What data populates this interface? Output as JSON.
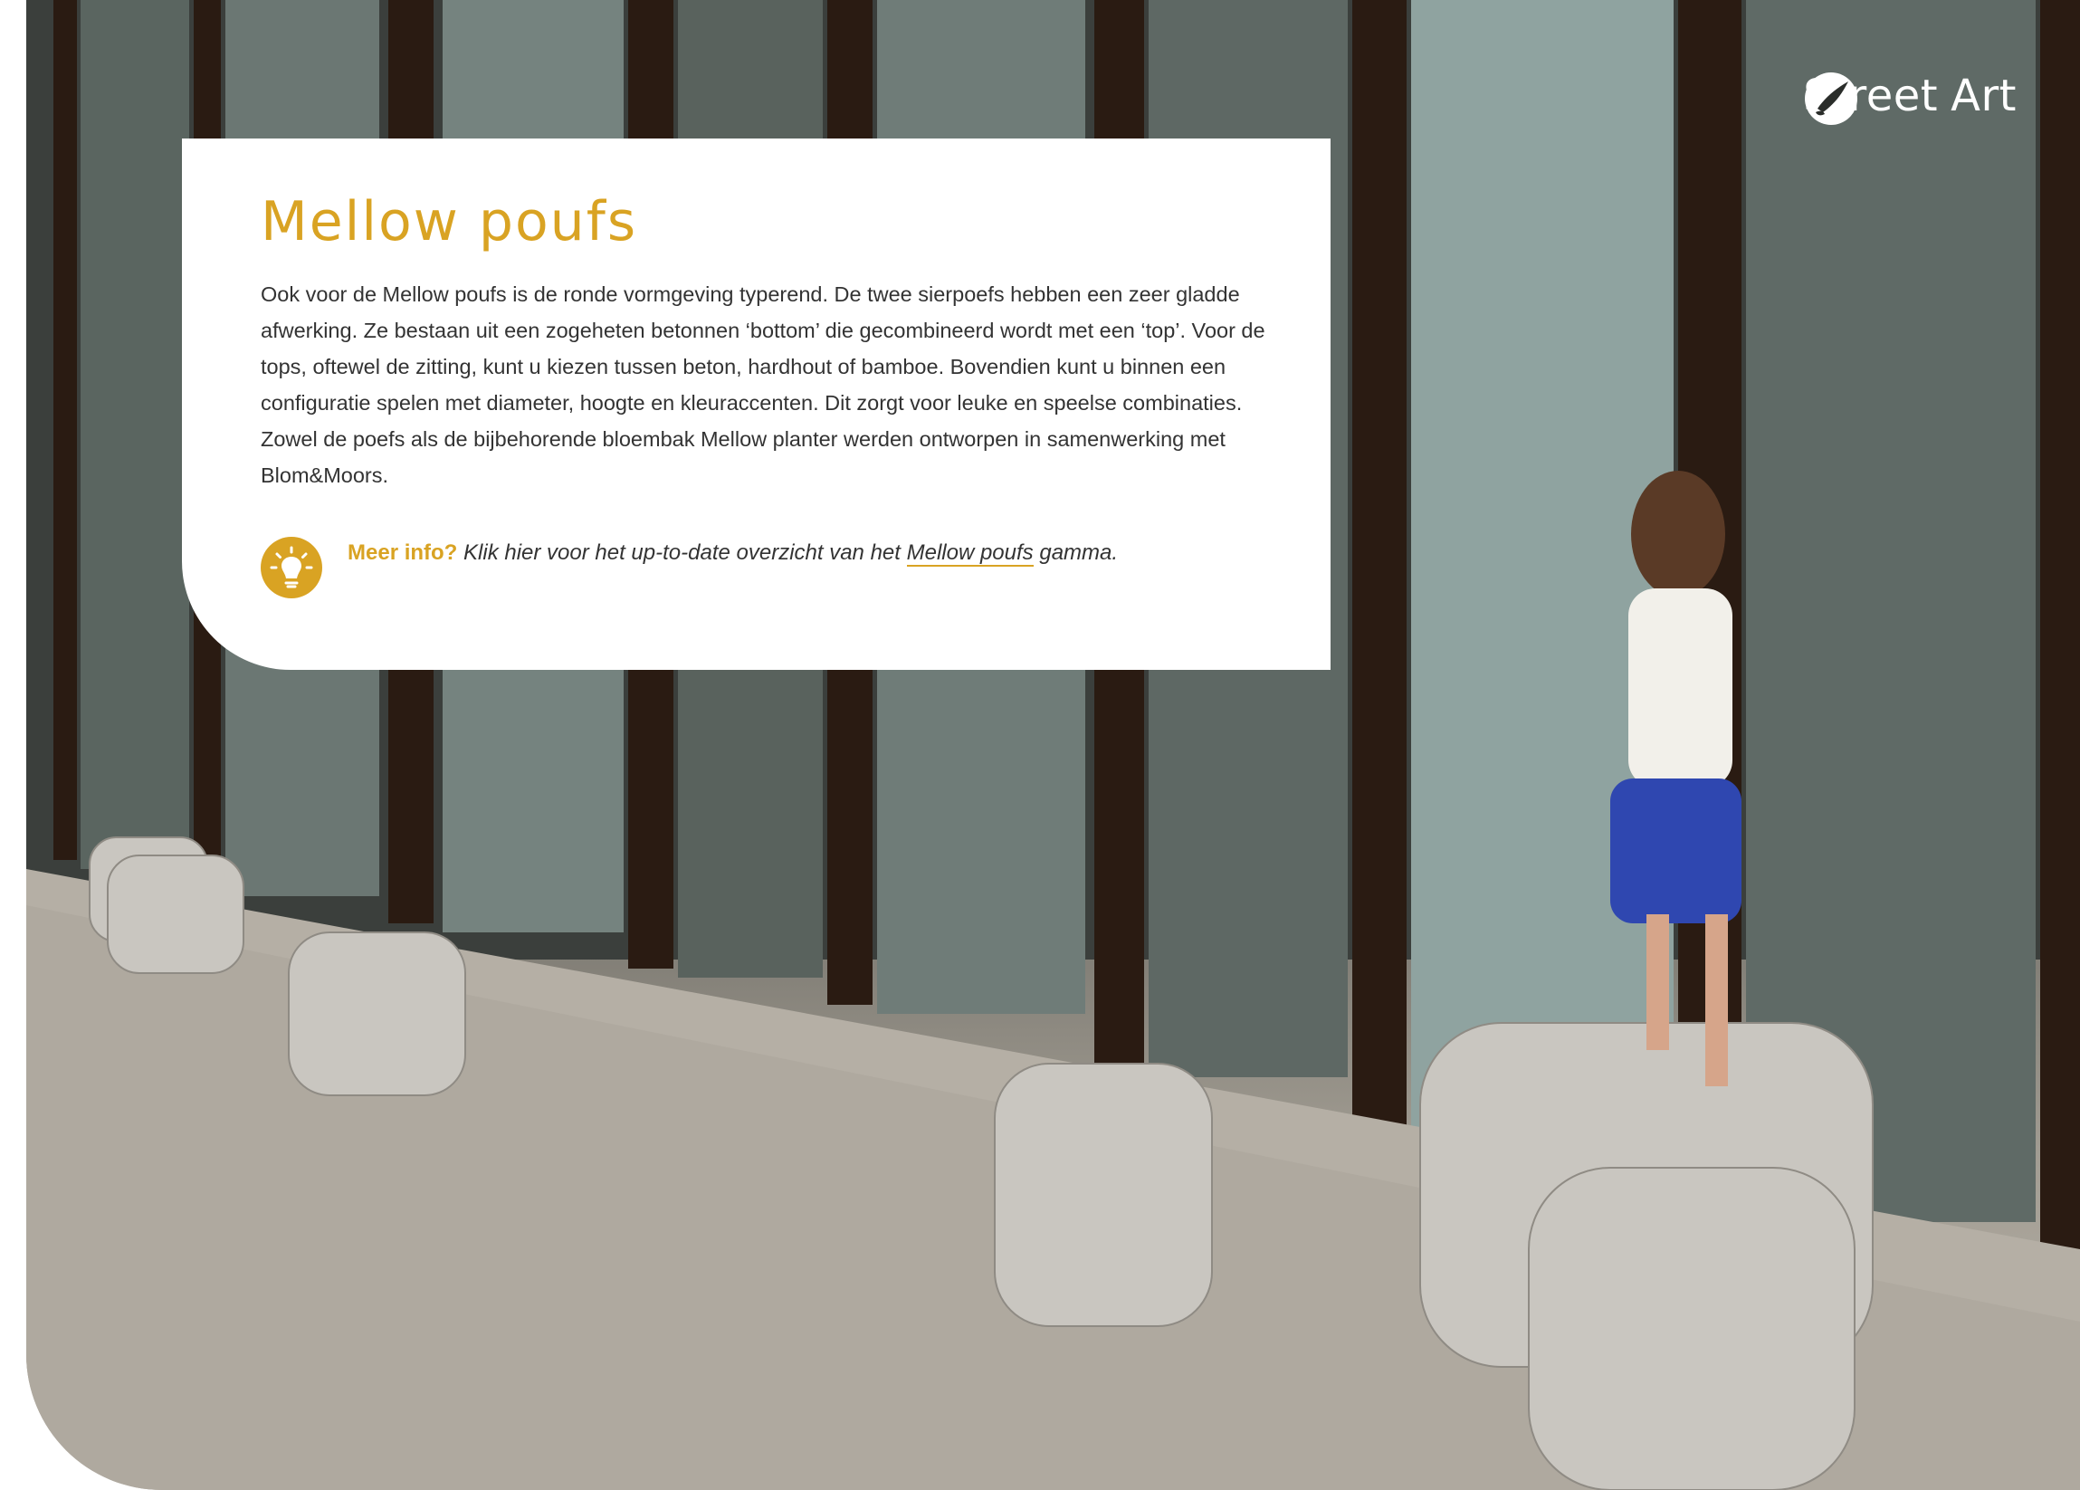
{
  "brand": {
    "name_left": "Street",
    "name_right": "Art",
    "accent": "#d9a323"
  },
  "card": {
    "title": "Mellow poufs",
    "body": "Ook voor de Mellow poufs is de ronde vormgeving typerend. De twee sierpoefs hebben een zeer gladde afwerking. Ze bestaan uit een zogeheten betonnen ‘bottom’ die gecombineerd wordt met een ‘top’. Voor de tops, oftewel de zitting, kunt u kiezen tussen beton, hardhout of bamboe. Bovendien kunt u binnen een configuratie spelen met diameter, hoogte en kleuraccenten. Dit zorgt voor leuke en speelse combinaties. Zowel de poefs als de bijbehorende bloembak Mellow planter werden ontworpen in samenwerking met Blom&Moors.",
    "info": {
      "icon": "lightbulb-icon",
      "label": "Meer info?",
      "text_before": "Klik hier voor het up-to-date overzicht van het",
      "link_text": "Mellow poufs",
      "text_after": "gamma."
    }
  }
}
